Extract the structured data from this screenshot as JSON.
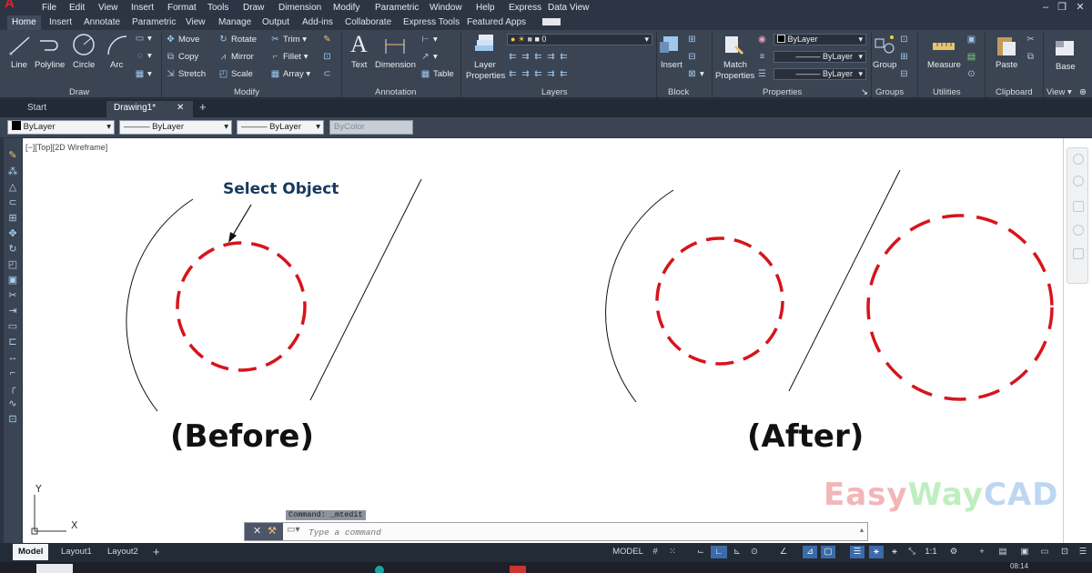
{
  "menubar": {
    "items": [
      "File",
      "Edit",
      "View",
      "Insert",
      "Format",
      "Tools",
      "Draw",
      "Dimension",
      "Modify",
      "Parametric",
      "Window",
      "Help",
      "Express",
      "Data View"
    ]
  },
  "ribbon_tabs": [
    "Home",
    "Insert",
    "Annotate",
    "Parametric",
    "View",
    "Manage",
    "Output",
    "Add-ins",
    "Collaborate",
    "Express Tools",
    "Featured Apps"
  ],
  "ribbon": {
    "draw": {
      "title": "Draw",
      "line": "Line",
      "polyline": "Polyline",
      "circle": "Circle",
      "arc": "Arc"
    },
    "modify": {
      "title": "Modify",
      "move": "Move",
      "rotate": "Rotate",
      "trim": "Trim",
      "copy": "Copy",
      "mirror": "Mirror",
      "fillet": "Fillet",
      "stretch": "Stretch",
      "scale": "Scale",
      "array": "Array"
    },
    "annotation": {
      "title": "Annotation",
      "text": "Text",
      "dimension": "Dimension",
      "table": "Table"
    },
    "layers": {
      "title": "Layers",
      "layer_properties_1": "Layer",
      "layer_properties_2": "Properties",
      "current_layer": "0"
    },
    "block": {
      "title": "Block",
      "insert": "Insert"
    },
    "properties": {
      "title": "Properties",
      "match_1": "Match",
      "match_2": "Properties",
      "color": "ByLayer",
      "linetype": "ByLayer",
      "lineweight": "ByLayer"
    },
    "groups": {
      "title": "Groups",
      "group": "Group"
    },
    "utilities": {
      "title": "Utilities",
      "measure": "Measure"
    },
    "clipboard": {
      "title": "Clipboard",
      "paste": "Paste"
    },
    "view": {
      "title": "View",
      "base": "Base"
    }
  },
  "file_tabs": {
    "start": "Start",
    "drawing": "Drawing1*"
  },
  "propbar": {
    "color": "ByLayer",
    "linetype": "ByLayer",
    "lineweight": "ByLayer",
    "plotstyle": "ByColor"
  },
  "canvas": {
    "viewport_label": "[−][Top][2D Wireframe]",
    "callout": "Select Object",
    "before": "(Before)",
    "after": "(After)",
    "watermark": {
      "part1": "Easy",
      "part2": "Way",
      "part3": "CAD"
    },
    "ucs_x": "X",
    "ucs_y": "Y"
  },
  "command": {
    "previous": "Command: _mtedit",
    "placeholder": "Type a command"
  },
  "layout_tabs": [
    "Model",
    "Layout1",
    "Layout2"
  ],
  "status": {
    "model": "MODEL",
    "scale": "1:1"
  },
  "clock": "08:14",
  "colors": {
    "accent_red": "#d7141d",
    "watermark_easy": "#f2b6b8",
    "watermark_way": "#bfeec0",
    "watermark_cad": "#bdd7f2"
  }
}
